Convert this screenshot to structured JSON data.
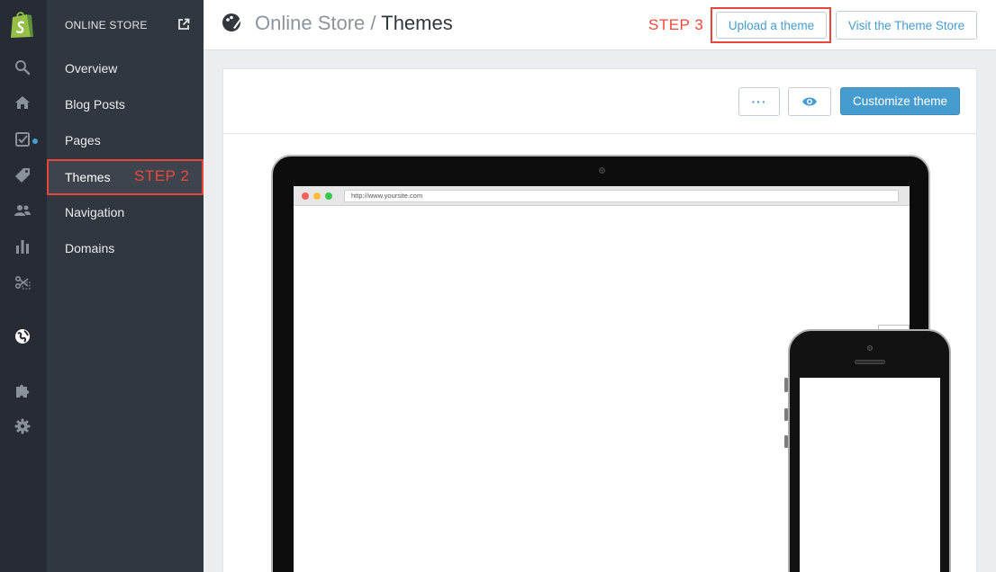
{
  "rail": {
    "icons": [
      "shopify-bag-icon",
      "search-icon",
      "home-icon",
      "orders-icon",
      "products-tag-icon",
      "customers-icon",
      "reports-icon",
      "discounts-icon",
      "online-store-globe-icon",
      "apps-puzzle-icon",
      "settings-gear-icon"
    ],
    "accent": "#479ccf"
  },
  "subnav": {
    "header": "ONLINE STORE",
    "items": [
      {
        "label": "Overview"
      },
      {
        "label": "Blog Posts"
      },
      {
        "label": "Pages"
      },
      {
        "label": "Themes",
        "active": true
      },
      {
        "label": "Navigation"
      },
      {
        "label": "Domains"
      }
    ]
  },
  "annotations": {
    "step2": "STEP 2",
    "step3": "STEP 3",
    "color": "#e8463c"
  },
  "header": {
    "breadcrumb_parent": "Online Store",
    "separator": " / ",
    "breadcrumb_current": "Themes",
    "upload_label": "Upload a theme",
    "visit_label": "Visit the Theme Store"
  },
  "toolbar": {
    "more_label": "···",
    "customize_label": "Customize theme",
    "primary_color": "#479ccf"
  },
  "preview": {
    "url": "http://www.yoursite.com"
  }
}
